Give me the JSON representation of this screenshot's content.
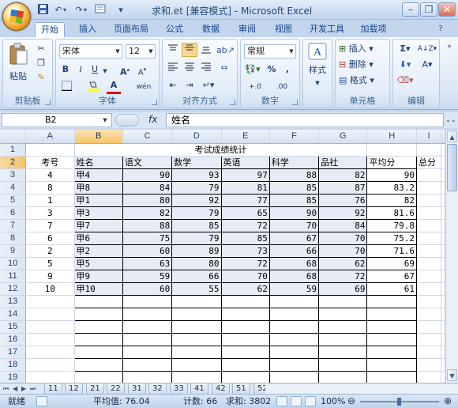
{
  "window": {
    "title": "求和.et  [兼容模式] - Microsoft Excel",
    "controls": {
      "minimize": "–",
      "restore": "❐",
      "close": "✕"
    }
  },
  "quick_access": {
    "save_icon": "save-icon",
    "undo": "↶",
    "redo": "↷",
    "customize": "▾"
  },
  "tabs": [
    "开始",
    "插入",
    "页面布局",
    "公式",
    "数据",
    "审阅",
    "视图",
    "开发工具",
    "加载项"
  ],
  "ribbon": {
    "clipboard": {
      "label": "剪贴板",
      "paste": "粘贴"
    },
    "font": {
      "label": "字体",
      "name": "宋体",
      "size": "12",
      "bold": "B",
      "italic": "I",
      "underline": "U",
      "grow": "A",
      "shrink": "A",
      "font_color": "A",
      "phonetic": "wén"
    },
    "alignment": {
      "label": "对齐方式"
    },
    "number": {
      "label": "数字",
      "format": "常规",
      "percent": "%",
      "comma": ",",
      "inc_decimal": "+.0",
      "dec_decimal": ".00"
    },
    "styles": {
      "label": "样式"
    },
    "cells": {
      "label": "单元格",
      "insert": "插入",
      "delete": "删除",
      "format": "格式"
    },
    "editing": {
      "label": "编辑",
      "sum": "Σ",
      "sort": "A↓Z",
      "find": "A"
    }
  },
  "formula_bar": {
    "name_box": "B2",
    "fx": "fx",
    "value": "姓名"
  },
  "columns": [
    "A",
    "B",
    "C",
    "D",
    "E",
    "F",
    "G",
    "H",
    "I"
  ],
  "selected_column": "B",
  "selected_row": "2",
  "row_headers": [
    "1",
    "2",
    "3",
    "4",
    "5",
    "6",
    "7",
    "8",
    "9",
    "10",
    "11",
    "12",
    "13",
    "14",
    "15",
    "16",
    "17",
    "18",
    "19"
  ],
  "sheet": {
    "title": "考试成绩统计",
    "headers": [
      "考号",
      "姓名",
      "语文",
      "数学",
      "英语",
      "科学",
      "品社",
      "平均分",
      "总分"
    ],
    "rows": [
      [
        "4",
        "甲4",
        "90",
        "93",
        "97",
        "88",
        "82",
        "90",
        ""
      ],
      [
        "8",
        "甲8",
        "84",
        "79",
        "81",
        "85",
        "87",
        "83.2",
        ""
      ],
      [
        "1",
        "甲1",
        "80",
        "92",
        "77",
        "85",
        "76",
        "82",
        ""
      ],
      [
        "3",
        "甲3",
        "82",
        "79",
        "65",
        "90",
        "92",
        "81.6",
        ""
      ],
      [
        "7",
        "甲7",
        "88",
        "85",
        "72",
        "70",
        "84",
        "79.8",
        ""
      ],
      [
        "6",
        "甲6",
        "75",
        "79",
        "85",
        "67",
        "70",
        "75.2",
        ""
      ],
      [
        "2",
        "甲2",
        "60",
        "89",
        "73",
        "66",
        "70",
        "71.6",
        ""
      ],
      [
        "5",
        "甲5",
        "63",
        "80",
        "72",
        "68",
        "62",
        "69",
        ""
      ],
      [
        "9",
        "甲9",
        "59",
        "66",
        "70",
        "68",
        "72",
        "67",
        ""
      ],
      [
        "10",
        "甲10",
        "60",
        "55",
        "62",
        "59",
        "69",
        "61",
        ""
      ]
    ]
  },
  "sheet_tabs": [
    "11",
    "12",
    "21",
    "22",
    "31",
    "32",
    "33",
    "41",
    "42",
    "51",
    "52"
  ],
  "status": {
    "ready": "就绪",
    "average": "平均值: 76.04",
    "count": "计数: 66",
    "sum": "求和: 3802",
    "zoom": "100%"
  }
}
